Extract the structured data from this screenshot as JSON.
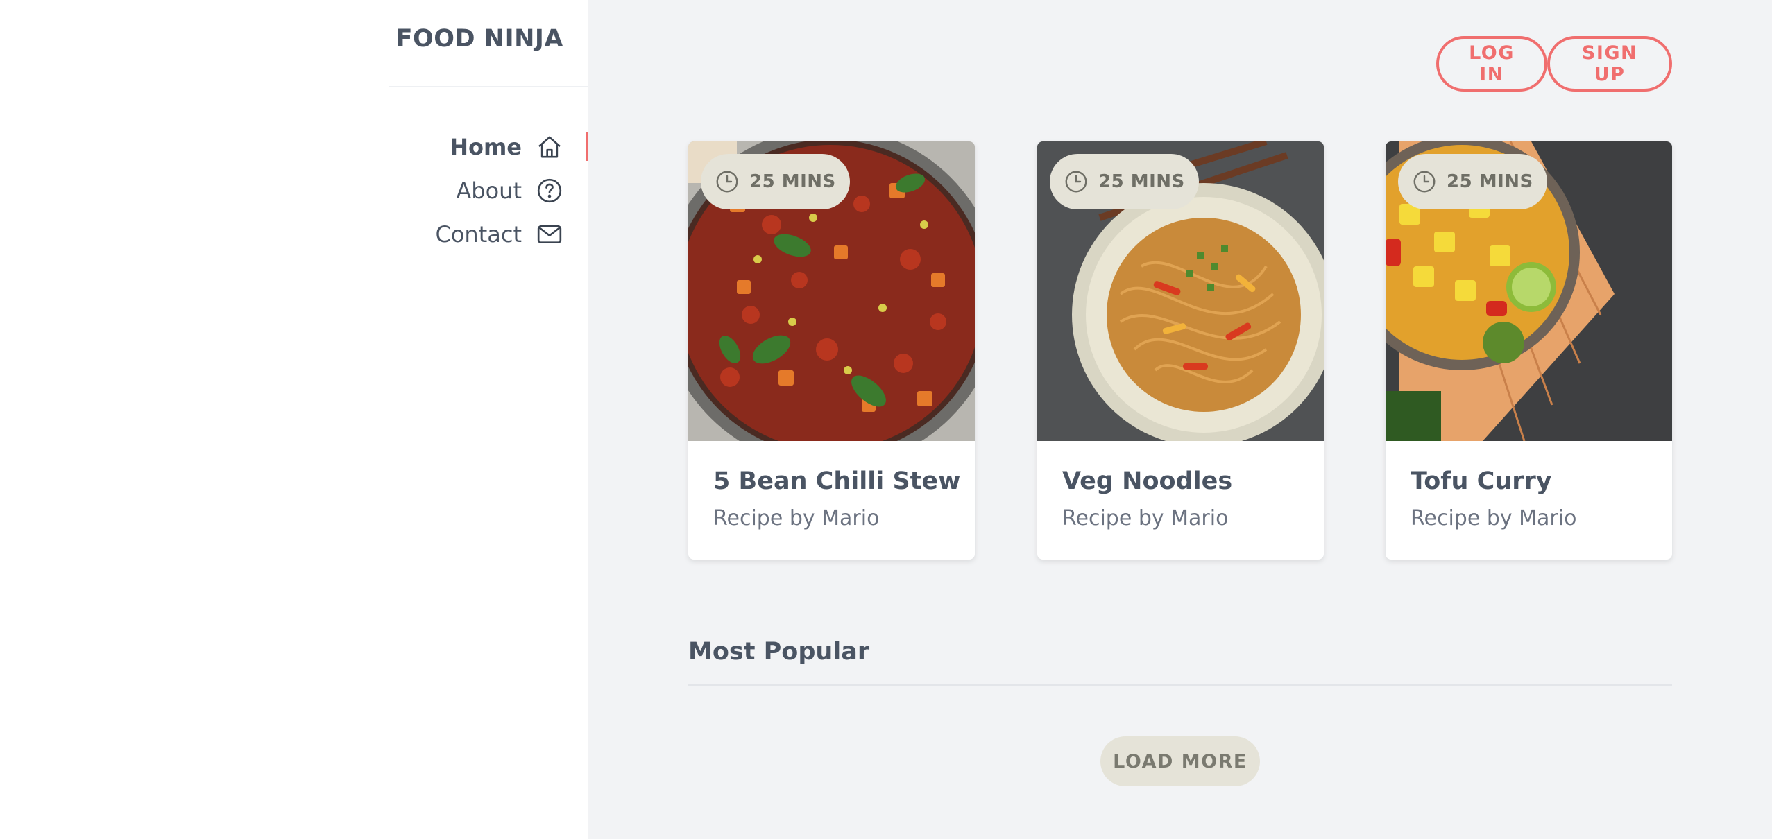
{
  "brand": {
    "name": "FOOD NINJA"
  },
  "nav": {
    "items": [
      {
        "label": "Home",
        "icon": "home-icon",
        "active": true
      },
      {
        "label": "About",
        "icon": "question-circle-icon",
        "active": false
      },
      {
        "label": "Contact",
        "icon": "mail-icon",
        "active": false
      }
    ]
  },
  "auth": {
    "login_label": "LOG IN",
    "signup_label": "SIGN UP"
  },
  "recipes": [
    {
      "title": "5 Bean Chilli Stew",
      "byline": "Recipe by Mario",
      "time": "25 MINS"
    },
    {
      "title": "Veg Noodles",
      "byline": "Recipe by Mario",
      "time": "25 MINS"
    },
    {
      "title": "Tofu Curry",
      "byline": "Recipe by Mario",
      "time": "25 MINS"
    }
  ],
  "popular": {
    "title": "Most Popular"
  },
  "load_more_label": "LOAD MORE",
  "colors": {
    "accent": "#f06e6e",
    "badge": "#e5e3d8",
    "sidebar_bg": "#ffffff",
    "main_bg": "#f2f3f5"
  }
}
